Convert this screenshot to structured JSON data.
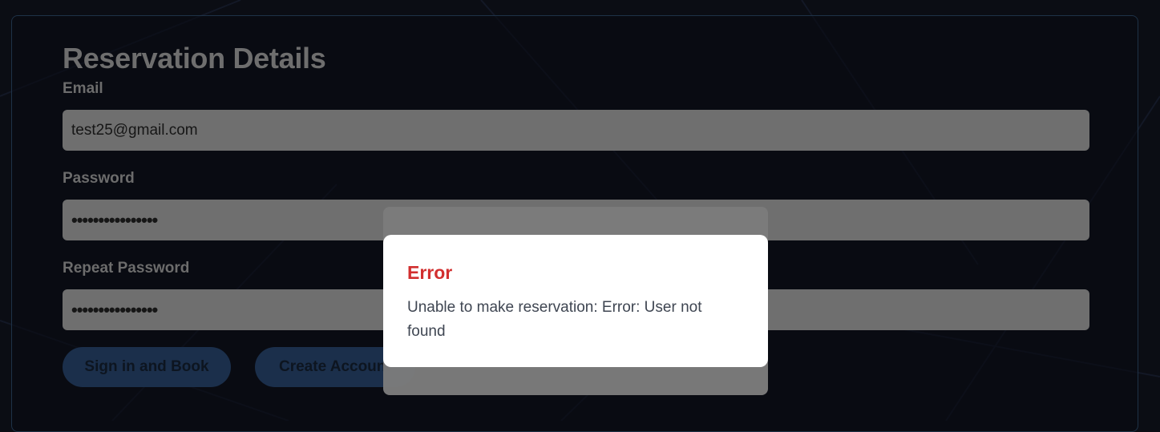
{
  "form": {
    "title": "Reservation Details",
    "email_label": "Email",
    "email_value": "test25@gmail.com",
    "password_label": "Password",
    "password_value": "••••••••••••••••",
    "repeat_password_label": "Repeat Password",
    "repeat_password_value": "••••••••••••••••",
    "signin_button": "Sign in and Book",
    "create_button": "Create Account"
  },
  "dialog": {
    "title": "Error",
    "message": "Unable to make reservation: Error: User not found"
  },
  "colors": {
    "background": "#0b0d14",
    "error_title": "#d22f2f",
    "button": "#1b2f4b"
  }
}
